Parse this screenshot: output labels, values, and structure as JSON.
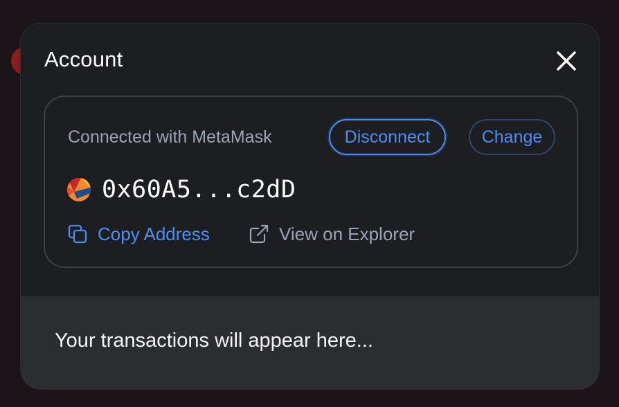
{
  "modal": {
    "title": "Account",
    "close_icon": "close-icon"
  },
  "account": {
    "connected_label": "Connected with MetaMask",
    "disconnect_label": "Disconnect",
    "change_label": "Change",
    "address": "0x60A5...c2dD",
    "identicon": "identicon-avatar",
    "copy_label": "Copy Address",
    "copy_icon": "copy-icon",
    "explorer_label": "View on Explorer",
    "explorer_icon": "external-link-icon"
  },
  "transactions": {
    "empty_message": "Your transactions will appear here..."
  },
  "colors": {
    "accent": "#4d8ef5",
    "modal_bg": "#1d1e22",
    "muted_text": "#9ca3b4",
    "tx_bg": "#2c2d31"
  }
}
